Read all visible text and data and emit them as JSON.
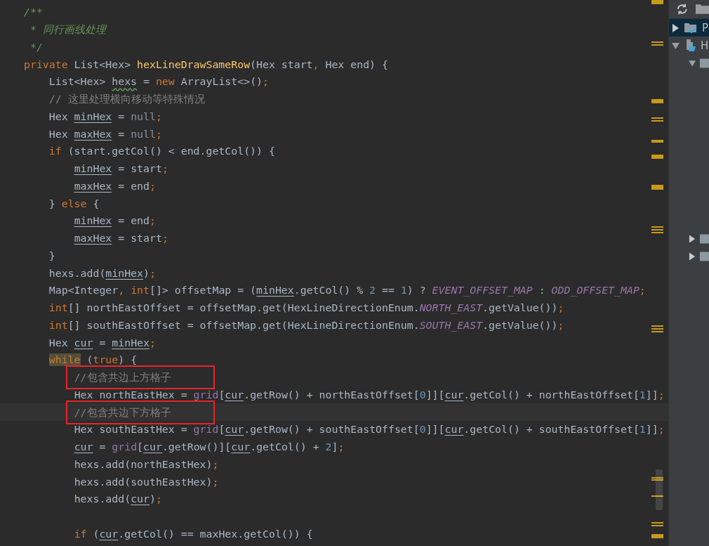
{
  "editor": {
    "lines": [
      {
        "tokens": [
          {
            "kind": "doc",
            "text": "/**"
          }
        ]
      },
      {
        "tokens": [
          {
            "kind": "doc",
            "text": " * 同行画线处理"
          }
        ]
      },
      {
        "tokens": [
          {
            "kind": "doc",
            "text": " */"
          }
        ]
      },
      {
        "tokens": [
          {
            "kind": "kw",
            "text": "private "
          },
          {
            "kind": "txt",
            "text": "List<Hex> "
          },
          {
            "kind": "fn",
            "text": "hexLineDrawSameRow"
          },
          {
            "kind": "txt",
            "text": "(Hex start"
          },
          {
            "kind": "kw",
            "text": ", "
          },
          {
            "kind": "txt",
            "text": "Hex end) {"
          }
        ]
      },
      {
        "tokens": [
          {
            "kind": "txt",
            "text": "    List<Hex> "
          },
          {
            "kind": "typo",
            "text": "hexs"
          },
          {
            "kind": "txt",
            "text": " = "
          },
          {
            "kind": "kw",
            "text": "new "
          },
          {
            "kind": "txt",
            "text": "ArrayList<>()"
          },
          {
            "kind": "kw",
            "text": ";"
          }
        ]
      },
      {
        "tokens": [
          {
            "kind": "cmt",
            "text": "    // 这里处理横向移动等特殊情况"
          }
        ]
      },
      {
        "tokens": [
          {
            "kind": "txt",
            "text": "    Hex "
          },
          {
            "kind": "var",
            "text": "minHex"
          },
          {
            "kind": "txt",
            "text": " = "
          },
          {
            "kind": "null",
            "text": "null"
          },
          {
            "kind": "kw",
            "text": ";"
          }
        ]
      },
      {
        "tokens": [
          {
            "kind": "txt",
            "text": "    Hex "
          },
          {
            "kind": "var",
            "text": "maxHex"
          },
          {
            "kind": "txt",
            "text": " = "
          },
          {
            "kind": "null",
            "text": "null"
          },
          {
            "kind": "kw",
            "text": ";"
          }
        ]
      },
      {
        "tokens": [
          {
            "kind": "kw",
            "text": "    if "
          },
          {
            "kind": "txt",
            "text": "(start.getCol() < end.getCol()) {"
          }
        ]
      },
      {
        "tokens": [
          {
            "kind": "var",
            "text": "        minHex"
          },
          {
            "kind": "txt",
            "text": " = start"
          },
          {
            "kind": "kw",
            "text": ";"
          }
        ]
      },
      {
        "tokens": [
          {
            "kind": "var",
            "text": "        maxHex"
          },
          {
            "kind": "txt",
            "text": " = end"
          },
          {
            "kind": "kw",
            "text": ";"
          }
        ]
      },
      {
        "tokens": [
          {
            "kind": "txt",
            "text": "    } "
          },
          {
            "kind": "kw",
            "text": "else "
          },
          {
            "kind": "txt",
            "text": "{"
          }
        ]
      },
      {
        "tokens": [
          {
            "kind": "var",
            "text": "        minHex"
          },
          {
            "kind": "txt",
            "text": " = end"
          },
          {
            "kind": "kw",
            "text": ";"
          }
        ]
      },
      {
        "tokens": [
          {
            "kind": "var",
            "text": "        maxHex"
          },
          {
            "kind": "txt",
            "text": " = start"
          },
          {
            "kind": "kw",
            "text": ";"
          }
        ]
      },
      {
        "tokens": [
          {
            "kind": "txt",
            "text": "    }"
          }
        ]
      },
      {
        "tokens": [
          {
            "kind": "txt",
            "text": "    hexs.add("
          },
          {
            "kind": "var",
            "text": "minHex"
          },
          {
            "kind": "txt",
            "text": ")"
          },
          {
            "kind": "kw",
            "text": ";"
          }
        ]
      },
      {
        "tokens": [
          {
            "kind": "txt",
            "text": "    Map<Integer"
          },
          {
            "kind": "kw",
            "text": ", int"
          },
          {
            "kind": "txt",
            "text": "[]> offsetMap = ("
          },
          {
            "kind": "var",
            "text": "minHex"
          },
          {
            "kind": "txt",
            "text": ".getCol() % "
          },
          {
            "kind": "num",
            "text": "2"
          },
          {
            "kind": "txt",
            "text": " == "
          },
          {
            "kind": "num",
            "text": "1"
          },
          {
            "kind": "txt",
            "text": ") ? "
          },
          {
            "kind": "const",
            "text": "EVENT_OFFSET_MAP"
          },
          {
            "kind": "txt",
            "text": " : "
          },
          {
            "kind": "const",
            "text": "ODD_OFFSET_MAP"
          },
          {
            "kind": "kw",
            "text": ";"
          }
        ]
      },
      {
        "tokens": [
          {
            "kind": "kw",
            "text": "    int"
          },
          {
            "kind": "txt",
            "text": "[] northEastOffset = offsetMap.get(HexLineDirectionEnum."
          },
          {
            "kind": "const",
            "text": "NORTH_EAST"
          },
          {
            "kind": "txt",
            "text": ".getValue())"
          },
          {
            "kind": "kw",
            "text": ";"
          }
        ]
      },
      {
        "tokens": [
          {
            "kind": "kw",
            "text": "    int"
          },
          {
            "kind": "txt",
            "text": "[] southEastOffset = offsetMap.get(HexLineDirectionEnum."
          },
          {
            "kind": "const",
            "text": "SOUTH_EAST"
          },
          {
            "kind": "txt",
            "text": ".getValue())"
          },
          {
            "kind": "kw",
            "text": ";"
          }
        ]
      },
      {
        "tokens": [
          {
            "kind": "txt",
            "text": "    Hex "
          },
          {
            "kind": "var",
            "text": "cur"
          },
          {
            "kind": "txt",
            "text": " = "
          },
          {
            "kind": "var",
            "text": "minHex"
          },
          {
            "kind": "kw",
            "text": ";"
          }
        ]
      },
      {
        "tokens": [
          {
            "kind": "match",
            "text": "    while"
          },
          {
            "kind": "txt",
            "text": " ("
          },
          {
            "kind": "kw",
            "text": "true"
          },
          {
            "kind": "txt",
            "text": ") {"
          }
        ]
      },
      {
        "boxed": true,
        "tokens": [
          {
            "kind": "cmt",
            "text": "        //包含共边上方格子"
          }
        ]
      },
      {
        "tokens": [
          {
            "kind": "txt",
            "text": "        Hex northEastHex = "
          },
          {
            "kind": "field",
            "text": "grid"
          },
          {
            "kind": "txt",
            "text": "["
          },
          {
            "kind": "var",
            "text": "cur"
          },
          {
            "kind": "txt",
            "text": ".getRow() + northEastOffset["
          },
          {
            "kind": "num",
            "text": "0"
          },
          {
            "kind": "txt",
            "text": "]]["
          },
          {
            "kind": "var",
            "text": "cur"
          },
          {
            "kind": "txt",
            "text": ".getCol() + northEastOffset["
          },
          {
            "kind": "num",
            "text": "1"
          },
          {
            "kind": "txt",
            "text": "]]"
          },
          {
            "kind": "kw",
            "text": ";"
          }
        ]
      },
      {
        "boxed": true,
        "current": true,
        "tokens": [
          {
            "kind": "cmt",
            "text": "        //包含共边下方格子"
          }
        ]
      },
      {
        "tokens": [
          {
            "kind": "txt",
            "text": "        Hex southEastHex = "
          },
          {
            "kind": "field",
            "text": "grid"
          },
          {
            "kind": "txt",
            "text": "["
          },
          {
            "kind": "var",
            "text": "cur"
          },
          {
            "kind": "txt",
            "text": ".getRow() + southEastOffset["
          },
          {
            "kind": "num",
            "text": "0"
          },
          {
            "kind": "txt",
            "text": "]]["
          },
          {
            "kind": "var",
            "text": "cur"
          },
          {
            "kind": "txt",
            "text": ".getCol() + southEastOffset["
          },
          {
            "kind": "num",
            "text": "1"
          },
          {
            "kind": "txt",
            "text": "]]"
          },
          {
            "kind": "kw",
            "text": ";"
          }
        ]
      },
      {
        "tokens": [
          {
            "kind": "var",
            "text": "        cur"
          },
          {
            "kind": "txt",
            "text": " = "
          },
          {
            "kind": "field",
            "text": "grid"
          },
          {
            "kind": "txt",
            "text": "["
          },
          {
            "kind": "var",
            "text": "cur"
          },
          {
            "kind": "txt",
            "text": ".getRow()]["
          },
          {
            "kind": "var",
            "text": "cur"
          },
          {
            "kind": "txt",
            "text": ".getCol() + "
          },
          {
            "kind": "num",
            "text": "2"
          },
          {
            "kind": "txt",
            "text": "]"
          },
          {
            "kind": "kw",
            "text": ";"
          }
        ]
      },
      {
        "tokens": [
          {
            "kind": "txt",
            "text": "        hexs.add(northEastHex)"
          },
          {
            "kind": "kw",
            "text": ";"
          }
        ]
      },
      {
        "tokens": [
          {
            "kind": "txt",
            "text": "        hexs.add(southEastHex)"
          },
          {
            "kind": "kw",
            "text": ";"
          }
        ]
      },
      {
        "tokens": [
          {
            "kind": "txt",
            "text": "        hexs.add("
          },
          {
            "kind": "var",
            "text": "cur"
          },
          {
            "kind": "txt",
            "text": ")"
          },
          {
            "kind": "kw",
            "text": ";"
          }
        ]
      },
      {
        "kind": "blank"
      },
      {
        "tokens": [
          {
            "kind": "kw",
            "text": "        if "
          },
          {
            "kind": "txt",
            "text": "("
          },
          {
            "kind": "var",
            "text": "cur"
          },
          {
            "kind": "txt",
            "text": ".getCol() == maxHex.getCol()) {"
          }
        ]
      }
    ]
  },
  "project_tree": [
    {
      "label": "P",
      "kind": "folder-check",
      "selected": true,
      "expanded": false
    },
    {
      "label": "H",
      "kind": "module",
      "selected": false,
      "expanded": true,
      "children": [
        {
          "kind": "folder",
          "selected": false,
          "expanded": true
        },
        {
          "kind": "folder",
          "selected": false,
          "expanded": false
        },
        {
          "kind": "folder",
          "selected": false,
          "expanded": false
        }
      ]
    }
  ]
}
